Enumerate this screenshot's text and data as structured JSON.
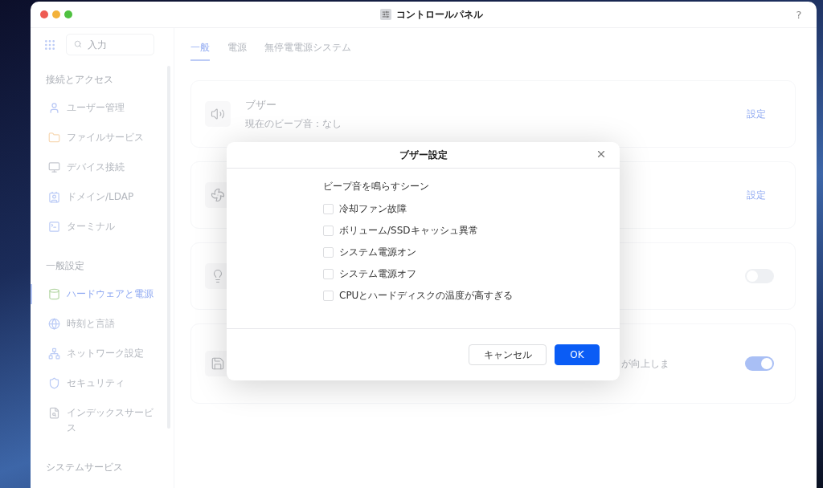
{
  "window": {
    "title": "コントロールパネル",
    "help": "?"
  },
  "sidebar": {
    "search": {
      "placeholder": "入力"
    },
    "sections": [
      {
        "title": "接続とアクセス",
        "items": [
          {
            "label": "ユーザー管理",
            "selected": false
          },
          {
            "label": "ファイルサービス",
            "selected": false
          },
          {
            "label": "デバイス接続",
            "selected": false
          },
          {
            "label": "ドメイン/LDAP",
            "selected": false
          },
          {
            "label": "ターミナル",
            "selected": false
          }
        ]
      },
      {
        "title": "一般設定",
        "items": [
          {
            "label": "ハードウェアと電源",
            "selected": true
          },
          {
            "label": "時刻と言語",
            "selected": false
          },
          {
            "label": "ネットワーク設定",
            "selected": false
          },
          {
            "label": "セキュリティ",
            "selected": false
          },
          {
            "label": "インデックスサービス",
            "selected": false
          }
        ]
      },
      {
        "title": "システムサービス"
      }
    ]
  },
  "tabs": [
    {
      "label": "一般",
      "selected": true
    },
    {
      "label": "電源",
      "selected": false
    },
    {
      "label": "無停電電源システム",
      "selected": false
    }
  ],
  "cards": [
    {
      "kind": "link",
      "title": "ブザー",
      "subtitle": "現在のビープ音：なし",
      "action": "設定"
    },
    {
      "kind": "link",
      "action": "設定"
    },
    {
      "kind": "toggle",
      "on": false
    },
    {
      "kind": "toggle",
      "on": true,
      "description": "が向上しま"
    }
  ],
  "dialog": {
    "title": "ブザー設定",
    "section_label": "ビープ音を鳴らすシーン",
    "options": [
      {
        "label": "冷却ファン故障",
        "checked": false
      },
      {
        "label": "ボリューム/SSDキャッシュ異常",
        "checked": false
      },
      {
        "label": "システム電源オン",
        "checked": false
      },
      {
        "label": "システム電源オフ",
        "checked": false
      },
      {
        "label": "CPUとハードディスクの温度が高すぎる",
        "checked": false
      }
    ],
    "buttons": [
      {
        "label": "キャンセル",
        "kind": "secondary"
      },
      {
        "label": "OK",
        "kind": "primary"
      }
    ]
  }
}
